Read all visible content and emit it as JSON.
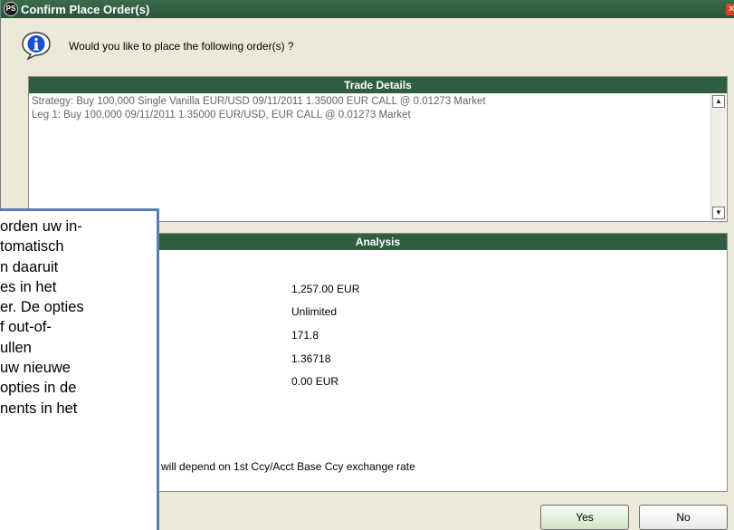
{
  "window": {
    "title": "Confirm Place Order(s)",
    "icon": "ps-app-icon",
    "close_glyph": "✕"
  },
  "prompt": "Would you like to place the following order(s) ?",
  "trade_details": {
    "header": "Trade Details",
    "lines": [
      "Strategy: Buy 100,000 Single Vanilla EUR/USD 09/11/2011 1.35000 EUR CALL @ 0.01273 Market",
      "Leg 1: Buy 100,000 09/11/2011 1.35000 EUR/USD, EUR CALL @ 0.01273 Market"
    ]
  },
  "analysis": {
    "header": "Analysis",
    "values": [
      "1,257.00 EUR",
      "Unlimited",
      "171.8",
      "1.36718",
      "0.00 EUR"
    ],
    "footnote": "will depend on 1st Ccy/Acct Base Ccy exchange rate"
  },
  "buttons": {
    "yes": "Yes",
    "no": "No"
  },
  "overlay": {
    "lines": [
      "orden uw in-",
      "tomatisch",
      "n daaruit",
      "es in het",
      "er. De opties",
      "f out-of-",
      "ullen",
      " uw nieuwe",
      " opties in de",
      "nents in het"
    ]
  },
  "colors": {
    "title_bar": "#2b543a",
    "panel_header": "#2f5d40",
    "overlay_border": "#5b7db4"
  }
}
